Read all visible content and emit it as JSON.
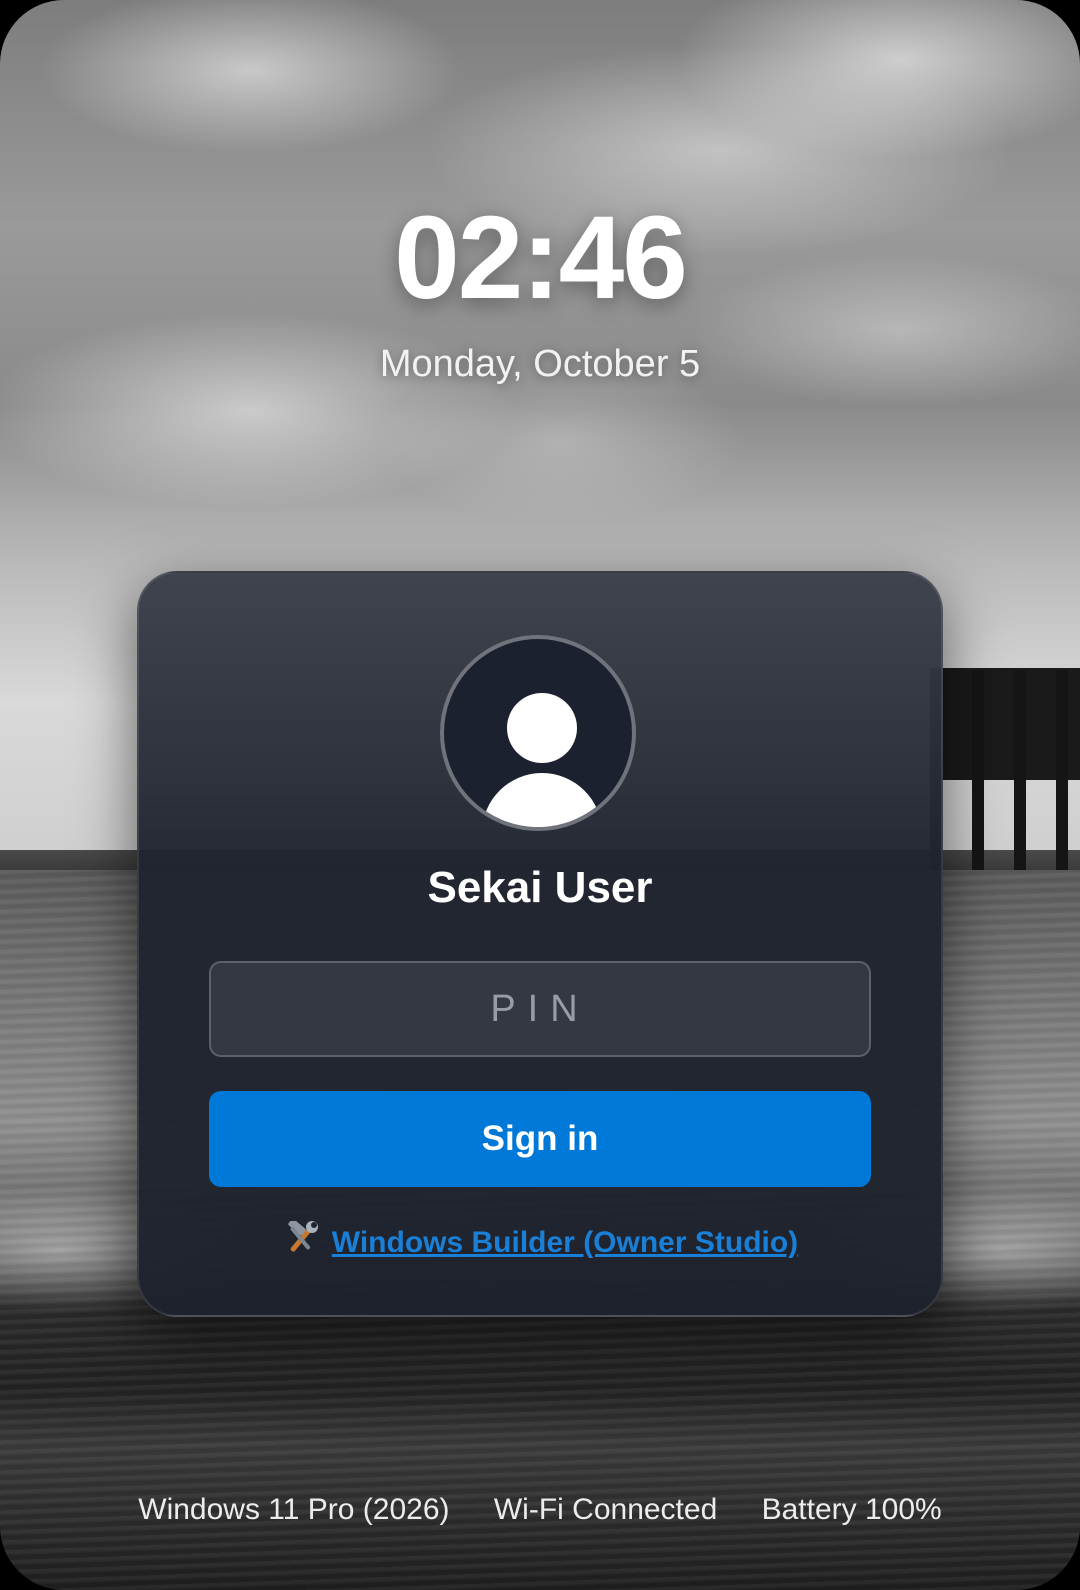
{
  "lockscreen": {
    "time": "02:46",
    "date": "Monday, October 5"
  },
  "login": {
    "username": "Sekai User",
    "pin_placeholder": "PIN",
    "pin_value": "",
    "signin_label": "Sign in",
    "builder_icon": "hammer-and-wrench-icon",
    "builder_link": "Windows Builder (Owner Studio)"
  },
  "status": {
    "os": "Windows 11 Pro (2026)",
    "wifi": "Wi-Fi Connected",
    "battery": "Battery 100%"
  },
  "colors": {
    "accent": "#0078d7",
    "link": "#1a7fd6",
    "card": "#20242e"
  }
}
